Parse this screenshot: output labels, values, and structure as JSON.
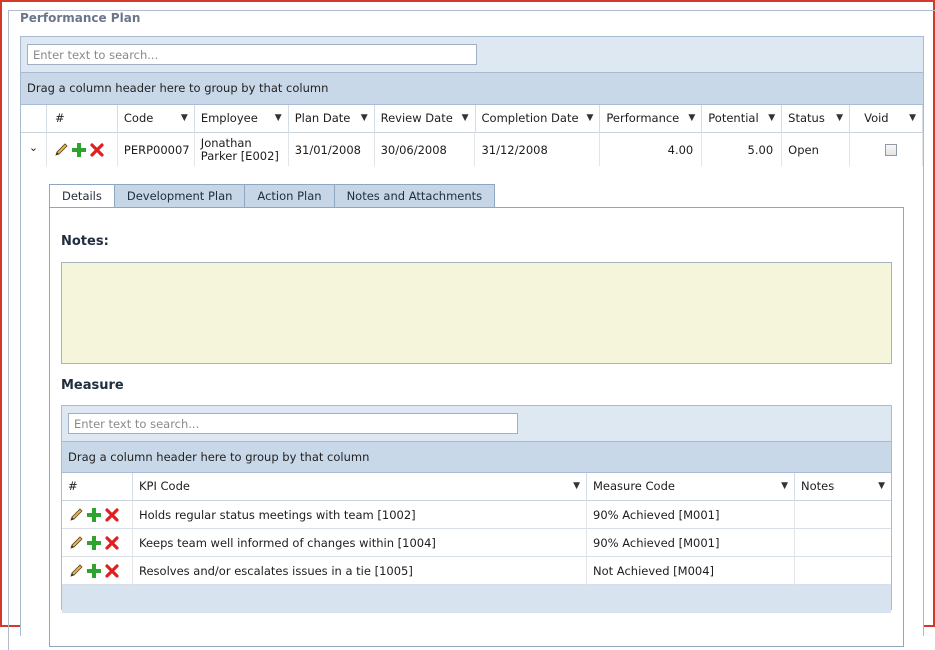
{
  "panel": {
    "title": "Performance Plan"
  },
  "grid": {
    "search_placeholder": "Enter text to search...",
    "group_hint": "Drag a column header here to group by that column",
    "columns": [
      "#",
      "Code",
      "Employee",
      "Plan Date",
      "Review Date",
      "Completion Date",
      "Performance",
      "Potential",
      "Status",
      "Void"
    ],
    "row": {
      "code": "PERP00007",
      "employee_line1": "Jonathan",
      "employee_line2": "Parker [E002]",
      "plan_date": "31/01/2008",
      "review_date": "30/06/2008",
      "completion_date": "31/12/2008",
      "performance": "4.00",
      "potential": "5.00",
      "status": "Open",
      "void": false
    }
  },
  "tabs": [
    "Details",
    "Development Plan",
    "Action Plan",
    "Notes and Attachments"
  ],
  "details": {
    "notes_label": "Notes:",
    "measure_label": "Measure"
  },
  "measure_grid": {
    "search_placeholder": "Enter text to search...",
    "group_hint": "Drag a column header here to group by that column",
    "columns": [
      "#",
      "KPI Code",
      "Measure Code",
      "Notes"
    ],
    "rows": [
      {
        "kpi": "Holds regular status meetings with team [1002]",
        "measure": "90% Achieved [M001]",
        "notes": ""
      },
      {
        "kpi": "Keeps team well informed of changes within [1004]",
        "measure": "90% Achieved [M001]",
        "notes": ""
      },
      {
        "kpi": "Resolves and/or escalates issues in a tie [1005]",
        "measure": "Not Achieved [M004]",
        "notes": ""
      }
    ]
  },
  "icons": {
    "edit": "pencil-icon",
    "add": "plus-icon",
    "delete": "delete-x-icon",
    "expand": "chevron-down-icon",
    "filter": "filter-icon"
  },
  "colors": {
    "frame": "#d43a2a",
    "header_bg": "#dde8f3",
    "group_bg": "#c9d8e8",
    "tab_bg": "#c6d6e6",
    "notes_bg": "#f5f5dc"
  }
}
